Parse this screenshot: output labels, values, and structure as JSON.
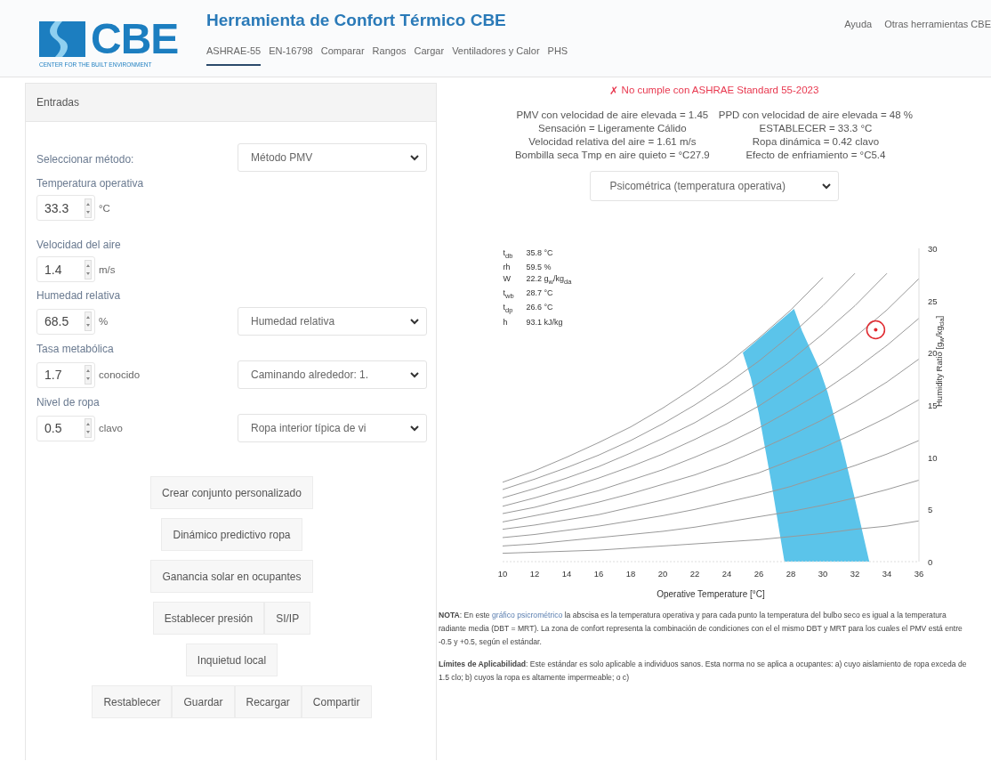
{
  "header": {
    "logo": {
      "mark": "CBE",
      "tagline": "CENTER FOR THE BUILT ENVIRONMENT"
    },
    "title": "Herramienta de Confort Térmico CBE",
    "tabs": [
      {
        "label": "ASHRAE-55",
        "selected": true
      },
      {
        "label": "EN-16798",
        "selected": false
      },
      {
        "label": "Comparar",
        "selected": false
      },
      {
        "label": "Rangos",
        "selected": false
      },
      {
        "label": "Cargar",
        "selected": false
      },
      {
        "label": "Ventiladores y Calor",
        "selected": false
      },
      {
        "label": "PHS",
        "selected": false
      }
    ],
    "links": [
      "Ayuda",
      "Otras herramientas CBE"
    ]
  },
  "inputs": {
    "title": "Entradas",
    "method": {
      "label": "Seleccionar método:",
      "select": "Método PMV"
    },
    "fields": [
      {
        "label": "Temperatura operativa",
        "value": "33.3",
        "unit": "°C"
      },
      {
        "label": "Velocidad del aire",
        "value": "1.4",
        "unit": "m/s"
      },
      {
        "label": "Humedad relativa",
        "value": "68.5",
        "unit": "%",
        "select": "Humedad relativa"
      },
      {
        "label": "Tasa metabólica",
        "value": "1.7",
        "unit": "conocido",
        "select": "Caminando alrededor: 1."
      },
      {
        "label": "Nivel de ropa",
        "value": "0.5",
        "unit": "clavo",
        "select": "Ropa interior típica de vi"
      }
    ],
    "button_groups": [
      [
        "Crear conjunto personalizado"
      ],
      [
        "Dinámico predictivo ropa"
      ],
      [
        "Ganancia solar en ocupantes"
      ],
      [
        "Establecer presión",
        "SI/IP"
      ],
      [
        "Inquietud local"
      ],
      [
        "Restablecer",
        "Guardar",
        "Recargar",
        "Compartir"
      ]
    ]
  },
  "results": {
    "status": {
      "compliant": false,
      "icon": "✗",
      "text": "No cumple con ASHRAE Standard 55-2023"
    },
    "values": [
      "PMV con velocidad de aire elevada = 1.45",
      "PPD con velocidad de aire elevada = 48 %",
      "Sensación = Ligeramente Cálido",
      "ESTABLECER = 33.3 °C",
      "Velocidad relativa del aire = 1.61 m/s",
      "Ropa dinámica = 0.42 clavo",
      "Bombilla seca Tmp en aire quieto = °C27.9",
      "Efecto de enfriamiento = °C5.4"
    ],
    "chart_select": "Psicométrica (temperatura operativa)",
    "legend": [
      {
        "label": "t$_{db}$",
        "value": "35.8",
        "unit": "°C"
      },
      {
        "label": "rh",
        "value": "59.5",
        "unit": "%"
      },
      {
        "label": "W",
        "value": "22.2",
        "unit": "g$_{w}$/kg$_{da}$"
      },
      {
        "label": "t$_{wb}$",
        "value": "28.7",
        "unit": "°C"
      },
      {
        "label": "t$_{dp}$",
        "value": "26.6",
        "unit": "°C"
      },
      {
        "label": "h",
        "value": "93.1",
        "unit": "kJ/kg"
      }
    ],
    "chart_data": {
      "type": "line",
      "xlabel": "Operative Temperature [°C]",
      "ylabel": "Humidity Ratio [g$_{w}$/kg$_{da}$]",
      "x": [
        10,
        12,
        14,
        16,
        18,
        20,
        22,
        24,
        26,
        28,
        30,
        32,
        34,
        36
      ],
      "xlim": [
        10,
        36
      ],
      "ylim": [
        0,
        30
      ],
      "xticks": [
        10,
        12,
        14,
        16,
        18,
        20,
        22,
        24,
        26,
        28,
        30,
        32,
        34,
        36
      ],
      "yticks": [
        0,
        5,
        10,
        15,
        20,
        25,
        30
      ],
      "series": [
        {
          "values": [
            0.8,
            0.9,
            1.0,
            1.1,
            1.3,
            1.5,
            1.7,
            1.9,
            2.1,
            2.4,
            2.7,
            3.1,
            3.4,
            3.9
          ]
        },
        {
          "values": [
            1.5,
            1.7,
            2.0,
            2.3,
            2.6,
            2.9,
            3.3,
            3.8,
            4.3,
            4.8,
            5.4,
            6.1,
            6.9,
            7.8
          ]
        },
        {
          "values": [
            2.3,
            2.6,
            3.0,
            3.4,
            3.9,
            4.4,
            5.0,
            5.7,
            6.4,
            7.2,
            8.2,
            9.2,
            10.3,
            11.6
          ]
        },
        {
          "values": [
            3.1,
            3.5,
            4.0,
            4.5,
            5.2,
            5.9,
            6.7,
            7.6,
            8.5,
            9.7,
            10.9,
            12.3,
            13.8,
            15.5
          ]
        },
        {
          "values": [
            3.8,
            4.4,
            5.0,
            5.7,
            6.5,
            7.4,
            8.3,
            9.4,
            10.7,
            12.1,
            13.6,
            15.3,
            17.2,
            19.4
          ]
        },
        {
          "values": [
            4.6,
            5.2,
            6.0,
            6.8,
            7.8,
            8.8,
            10.0,
            11.3,
            12.8,
            14.5,
            16.3,
            18.4,
            20.7,
            23.3
          ]
        },
        {
          "values": [
            5.3,
            6.1,
            7.0,
            8.0,
            9.1,
            10.3,
            11.7,
            13.2,
            14.9,
            16.9,
            19.0,
            21.5,
            24.1,
            27.1
          ]
        },
        {
          "values": [
            6.1,
            7.0,
            8.0,
            9.1,
            10.4,
            11.8,
            13.3,
            15.1,
            17.1,
            19.3,
            21.8,
            24.5,
            27.6,
            null
          ]
        },
        {
          "values": [
            6.9,
            7.9,
            9.0,
            10.2,
            11.6,
            13.2,
            15.0,
            17.0,
            19.2,
            21.7,
            24.5,
            27.6,
            null,
            null
          ]
        },
        {
          "values": [
            7.6,
            8.7,
            10.0,
            11.4,
            12.9,
            14.7,
            16.7,
            18.9,
            21.4,
            24.1,
            27.2,
            null,
            null,
            null
          ]
        }
      ]
    },
    "notes": [
      {
        "before": "**NOTA**: En este ",
        "link": "gráfico psicrométrico",
        "after": " la abscisa es la temperatura operativa y para cada punto la temperatura del bulbo seco es igual a la temperatura radiante media (DBT = MRT). La zona de confort representa la combinación de condiciones con el el mismo DBT y MRT para los cuales el PMV está entre -0.5 y +0.5, según el estándar."
      },
      {
        "before": "**Límites de Aplicabilidad**: Este estándar es solo aplicable a individuos sanos. Esta norma no se aplica a ocupantes: a) cuyo aislamiento de ropa exceda de 1.5 clo; b) cuyos la ropa es altamente impermeable; o c)"
      }
    ]
  }
}
